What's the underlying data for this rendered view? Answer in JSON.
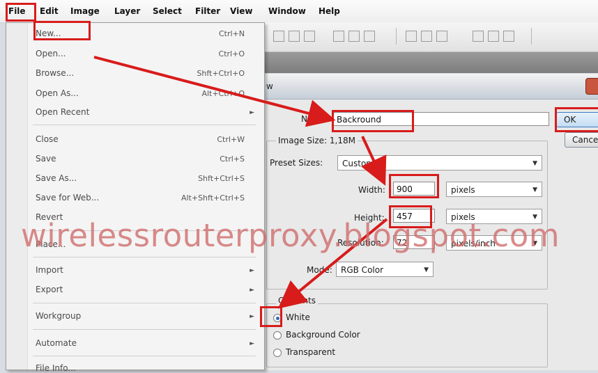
{
  "menubar": {
    "items": [
      "File",
      "Edit",
      "Image",
      "Layer",
      "Select",
      "Filter",
      "View",
      "Window",
      "Help"
    ]
  },
  "file_menu": {
    "items": [
      {
        "label": "New...",
        "shortcut": "Ctrl+N"
      },
      {
        "label": "Open...",
        "shortcut": "Ctrl+O"
      },
      {
        "label": "Browse...",
        "shortcut": "Shft+Ctrl+O"
      },
      {
        "label": "Open As...",
        "shortcut": "Alt+Ctrl+O"
      },
      {
        "label": "Open Recent",
        "shortcut": ""
      },
      {
        "label": "Close",
        "shortcut": "Ctrl+W"
      },
      {
        "label": "Save",
        "shortcut": "Ctrl+S"
      },
      {
        "label": "Save As...",
        "shortcut": "Shft+Ctrl+S"
      },
      {
        "label": "Save for Web...",
        "shortcut": "Alt+Shft+Ctrl+S"
      },
      {
        "label": "Revert",
        "shortcut": ""
      },
      {
        "label": "Place...",
        "shortcut": ""
      },
      {
        "label": "Import",
        "shortcut": ""
      },
      {
        "label": "Export",
        "shortcut": ""
      },
      {
        "label": "Workgroup",
        "shortcut": ""
      },
      {
        "label": "Automate",
        "shortcut": ""
      },
      {
        "label": "File Info...",
        "shortcut": ""
      }
    ]
  },
  "dialog": {
    "title": "w",
    "name_label": "Name:",
    "name_value": "Backround",
    "image_size": "Image Size: 1,18M",
    "preset_label": "Preset Sizes:",
    "preset_value": "Custom",
    "width_label": "Width:",
    "width_value": "900",
    "width_unit": "pixels",
    "height_label": "Height:",
    "height_value": "457",
    "height_unit": "pixels",
    "resolution_label": "Resolution:",
    "resolution_value": "72",
    "resolution_unit": "pixels/inch",
    "mode_label": "Mode:",
    "mode_value": "RGB Color",
    "contents_label": "Contents",
    "contents_options": [
      "White",
      "Background Color",
      "Transparent"
    ],
    "ok_label": "OK",
    "cancel_label": "Cancel"
  },
  "watermark": "wirelessrouterproxy.blogspot.com",
  "colors": {
    "annotation_red": "#d81b1b",
    "watermark": "#cf6b6b"
  }
}
